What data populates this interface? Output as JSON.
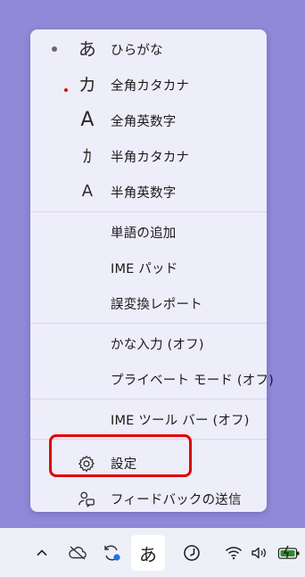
{
  "menu": {
    "input_modes": [
      {
        "glyph": "あ",
        "label": "ひらがな",
        "selected": true
      },
      {
        "glyph": "カ",
        "label": "全角カタカナ"
      },
      {
        "glyph": "A",
        "label": "全角英数字"
      },
      {
        "glyph": "ｶ",
        "label": "半角カタカナ"
      },
      {
        "glyph": "A",
        "label": "半角英数字"
      }
    ],
    "tools": [
      {
        "label": "単語の追加"
      },
      {
        "label": "IME パッド"
      },
      {
        "label": "誤変換レポート"
      }
    ],
    "options": [
      {
        "label": "かな入力 (オフ)"
      },
      {
        "label": "プライベート モード (オフ)"
      }
    ],
    "toolbar_option": {
      "label": "IME ツール バー (オフ)"
    },
    "settings": {
      "label": "設定",
      "icon": "gear-icon"
    },
    "feedback": {
      "label": "フィードバックの送信",
      "icon": "feedback-icon"
    }
  },
  "taskbar": {
    "ime_indicator": "あ",
    "icons": [
      "chevron-up-icon",
      "cloud-off-icon",
      "sync-icon",
      "ime-indicator",
      "clock-icon",
      "wifi-icon",
      "volume-icon",
      "battery-icon"
    ]
  },
  "colors": {
    "background": "#9089d8",
    "menu": "#eeedfa",
    "highlight": "#e00000",
    "taskbar": "#eef0f8",
    "accent": "#1a73e8",
    "battery": "#2e8b2e"
  }
}
